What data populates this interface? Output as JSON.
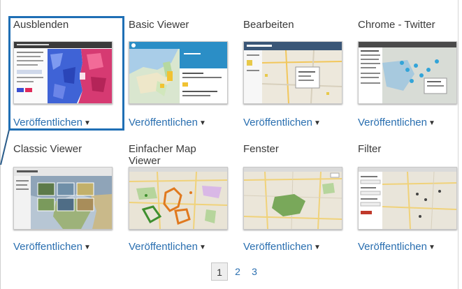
{
  "gallery": {
    "items": [
      {
        "title": "Ausblenden",
        "publish_label": "Veröffentlichen"
      },
      {
        "title": "Basic Viewer",
        "publish_label": "Veröffentlichen"
      },
      {
        "title": "Bearbeiten",
        "publish_label": "Veröffentlichen"
      },
      {
        "title": "Chrome - Twitter",
        "publish_label": "Veröffentlichen"
      },
      {
        "title": "Classic Viewer",
        "publish_label": "Veröffentlichen"
      },
      {
        "title": "Einfacher Map Viewer",
        "publish_label": "Veröffentlichen"
      },
      {
        "title": "Fenster",
        "publish_label": "Veröffentlichen"
      },
      {
        "title": "Filter",
        "publish_label": "Veröffentlichen"
      }
    ],
    "selected_index": 0
  },
  "pagination": {
    "pages": [
      "1",
      "2",
      "3"
    ],
    "current": "1"
  },
  "colors": {
    "link": "#2a6fb0",
    "selection": "#1f6fb5"
  },
  "icons": {
    "dropdown": "caret-down-icon"
  }
}
